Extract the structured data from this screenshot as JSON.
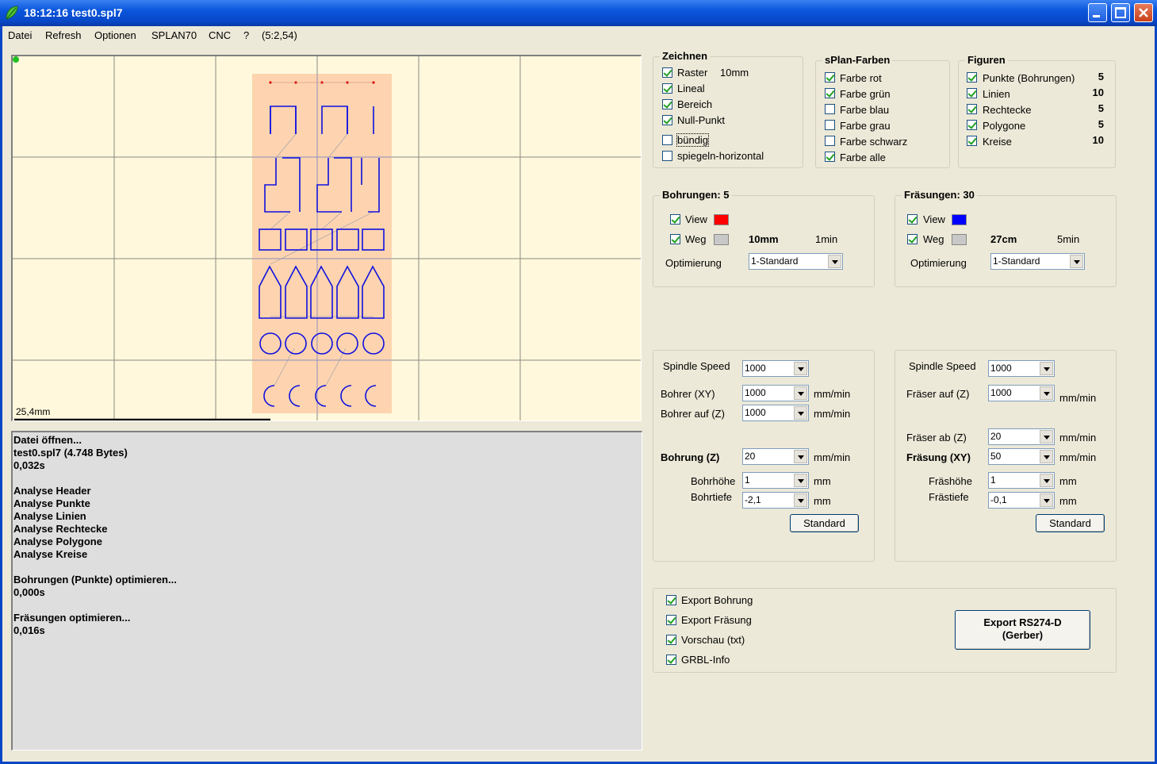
{
  "window": {
    "title": "18:12:16  test0.spl7"
  },
  "menu": [
    "Datei",
    "Refresh",
    "Optionen",
    "SPLAN70",
    "CNC",
    "?",
    "(5:2,54)"
  ],
  "canvas": {
    "scale_label": "25,4mm"
  },
  "log": [
    "Datei öffnen...",
    "test0.spl7   (4.748 Bytes)",
    "0,032s",
    "",
    "Analyse Header",
    "Analyse Punkte",
    "Analyse Linien",
    "Analyse Rechtecke",
    "Analyse Polygone",
    "Analyse Kreise",
    "",
    "Bohrungen (Punkte) optimieren...",
    "0,000s",
    "",
    "Fräsungen optimieren...",
    "0,016s"
  ],
  "zeichnen": {
    "title": "Zeichnen",
    "items": [
      {
        "label": "Raster",
        "checked": true,
        "extra": "10mm"
      },
      {
        "label": "Lineal",
        "checked": true
      },
      {
        "label": "Bereich",
        "checked": true
      },
      {
        "label": "Null-Punkt",
        "checked": true
      },
      {
        "label": "bündig",
        "checked": false
      },
      {
        "label": "spiegeln-horizontal",
        "checked": false
      }
    ]
  },
  "farben": {
    "title": "sPlan-Farben",
    "items": [
      {
        "label": "Farbe rot",
        "checked": true
      },
      {
        "label": "Farbe grün",
        "checked": true
      },
      {
        "label": "Farbe blau",
        "checked": false
      },
      {
        "label": "Farbe grau",
        "checked": false
      },
      {
        "label": "Farbe schwarz",
        "checked": false
      },
      {
        "label": "Farbe alle",
        "checked": true
      }
    ]
  },
  "figuren": {
    "title": "Figuren",
    "items": [
      {
        "label": "Punkte (Bohrungen)",
        "checked": true,
        "count": "5"
      },
      {
        "label": "Linien",
        "checked": true,
        "count": "10"
      },
      {
        "label": "Rechtecke",
        "checked": true,
        "count": "5"
      },
      {
        "label": "Polygone",
        "checked": true,
        "count": "5"
      },
      {
        "label": "Kreise",
        "checked": true,
        "count": "10"
      }
    ]
  },
  "bohrungen": {
    "title": "Bohrungen: 5",
    "view_label": "View",
    "view_color": "#ff0000",
    "weg_label": "Weg",
    "distance": "10mm",
    "time": "1min",
    "opt_label": "Optimierung",
    "opt_value": "1-Standard"
  },
  "fraesungen": {
    "title": "Fräsungen: 30",
    "view_label": "View",
    "view_color": "#0000ff",
    "weg_label": "Weg",
    "distance": "27cm",
    "time": "5min",
    "opt_label": "Optimierung",
    "opt_value": "1-Standard"
  },
  "bohr_params": {
    "spindle_label": "Spindle Speed",
    "spindle": "1000",
    "xy_label": "Bohrer (XY)",
    "xy": "1000",
    "xy_unit": "mm/min",
    "auf_label": "Bohrer auf (Z)",
    "auf": "1000",
    "auf_unit": "mm/min",
    "z_label": "Bohrung (Z)",
    "z": "20",
    "z_unit": "mm/min",
    "hoehe_label": "Bohrhöhe",
    "hoehe": "1",
    "hoehe_unit": "mm",
    "tiefe_label": "Bohrtiefe",
    "tiefe": "-2,1",
    "tiefe_unit": "mm",
    "std_label": "Standard"
  },
  "fraes_params": {
    "spindle_label": "Spindle Speed",
    "spindle": "1000",
    "auf_label": "Fräser auf (Z)",
    "auf": "1000",
    "auf_unit": "mm/min",
    "ab_label": "Fräser ab (Z)",
    "ab": "20",
    "ab_unit": "mm/min",
    "xy_label": "Fräsung (XY)",
    "xy": "50",
    "xy_unit": "mm/min",
    "hoehe_label": "Fräshöhe",
    "hoehe": "1",
    "hoehe_unit": "mm",
    "tiefe_label": "Frästiefe",
    "tiefe": "-0,1",
    "tiefe_unit": "mm",
    "std_label": "Standard"
  },
  "export": {
    "items": [
      {
        "label": "Export Bohrung",
        "checked": true
      },
      {
        "label": "Export Fräsung",
        "checked": true
      },
      {
        "label": "Vorschau (txt)",
        "checked": true
      },
      {
        "label": "GRBL-Info",
        "checked": true
      }
    ],
    "button_line1": "Export RS274-D",
    "button_line2": "(Gerber)"
  }
}
